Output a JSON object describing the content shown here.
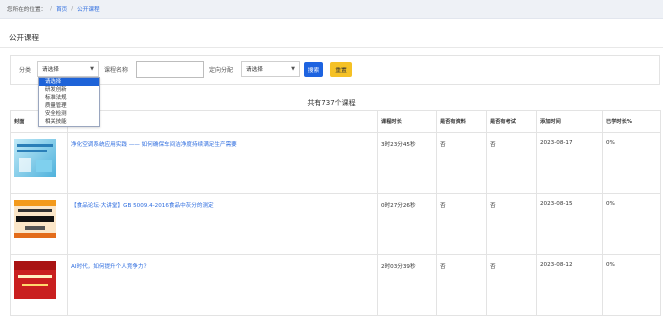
{
  "breadcrumb": {
    "prefix": "您所在的位置：",
    "sep": "/",
    "home": "首页",
    "current": "公开课程"
  },
  "page_title": "公开课程",
  "filters": {
    "category_label": "分类",
    "category_selected": "请选择",
    "course_name_label": "课程名称",
    "course_name_value": "",
    "assign_label": "定向分配",
    "assign_selected": "请选择",
    "search_button": "搜索",
    "reset_button": "重置"
  },
  "dropdown_options": [
    "请选择",
    "研发创新",
    "标准法规",
    "质量管理",
    "安全检测",
    "相关技能"
  ],
  "summary": "共有737个课程",
  "table": {
    "headers": [
      "封面",
      "课程名称",
      "课程时长",
      "是否有资料",
      "是否有考试",
      "添加时间",
      "已学时长%"
    ],
    "rows": [
      {
        "name": "净化空调系统应用实践 —— 如何确保车间洁净度持续满足生产需要",
        "duration": "3时23分45秒",
        "has_material": "否",
        "has_exam": "否",
        "added": "2023-08-17",
        "progress": "0%"
      },
      {
        "name": "【食品论坛·大讲堂】GB 5009.4-2016食品中灰分的测定",
        "duration": "0时27分26秒",
        "has_material": "否",
        "has_exam": "否",
        "added": "2023-08-15",
        "progress": "0%"
      },
      {
        "name": "AI时代，如何提升个人竞争力？",
        "duration": "2时03分39秒",
        "has_material": "否",
        "has_exam": "否",
        "added": "2023-08-12",
        "progress": "0%"
      }
    ]
  },
  "colors": {
    "accent": "#1d63e0",
    "reset": "#f5c125",
    "link": "#2d6cdf",
    "breadcrumb_bg": "#eef1f6"
  }
}
